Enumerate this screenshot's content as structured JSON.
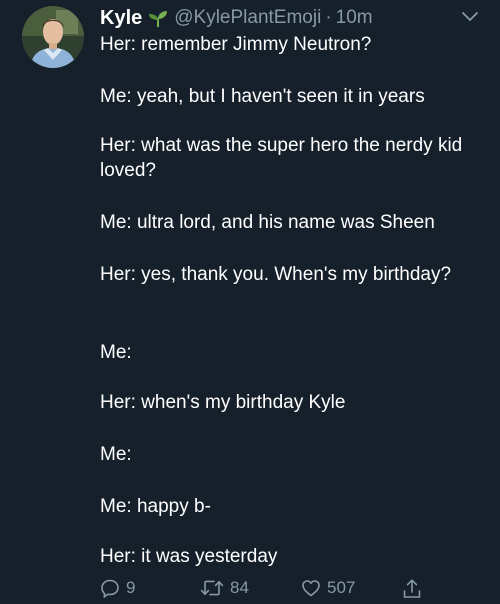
{
  "tweet": {
    "author_name": "Kyle",
    "author_emoji": "seedling-icon",
    "handle": "@KylePlantEmoji",
    "separator": "·",
    "time": "10m",
    "lines": [
      "Her: remember Jimmy Neutron?",
      "Me: yeah, but I haven't seen it in years",
      "Her: what was the super hero the nerdy kid loved?",
      "Me: ultra lord, and his name was Sheen",
      "Her: yes, thank you. When's my birthday?",
      "Me:",
      "Her: when's my birthday Kyle",
      "Me:",
      "Me: happy b-",
      "Her: it was yesterday"
    ]
  },
  "actions": {
    "reply_count": "9",
    "retweet_count": "84",
    "like_count": "507"
  },
  "colors": {
    "background": "#15202b",
    "text": "#ffffff",
    "secondary": "#8899a6",
    "plant_green": "#77b255"
  }
}
